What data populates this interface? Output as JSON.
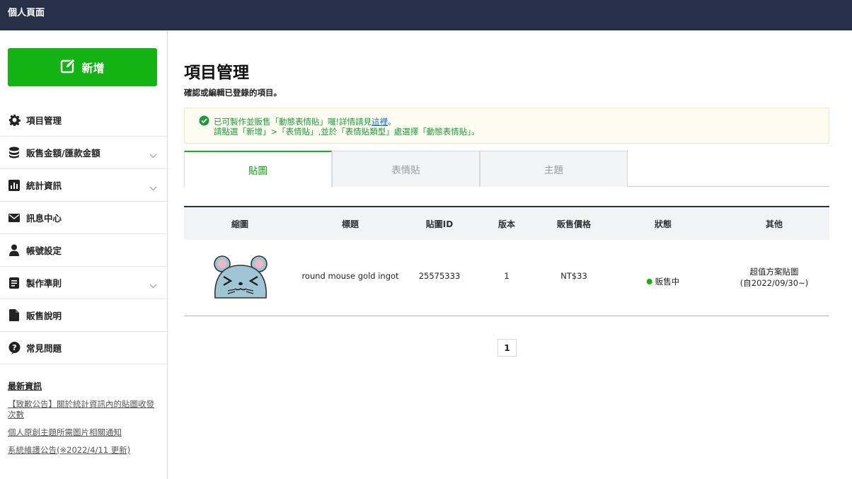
{
  "header": {
    "title": "個人頁面"
  },
  "sidebar": {
    "new_button_label": "新增",
    "items": [
      {
        "label": "項目管理",
        "icon": "gear-icon",
        "has_chevron": false
      },
      {
        "label": "販售金額/匯款金額",
        "icon": "coins-icon",
        "has_chevron": true
      },
      {
        "label": "統計資訊",
        "icon": "bar-chart-icon",
        "has_chevron": true
      },
      {
        "label": "訊息中心",
        "icon": "mail-icon",
        "has_chevron": false
      },
      {
        "label": "帳號設定",
        "icon": "user-icon",
        "has_chevron": false
      },
      {
        "label": "製作準則",
        "icon": "document-icon",
        "has_chevron": true
      },
      {
        "label": "販售說明",
        "icon": "file-icon",
        "has_chevron": false
      },
      {
        "label": "常見問題",
        "icon": "question-icon",
        "has_chevron": false
      }
    ],
    "news": {
      "title": "最新資訊",
      "links": [
        "【致歉公告】關於統計資訊內的貼圖收發次數",
        "個人原創主題所需圖片相關通知",
        "系統維護公告(※2022/4/11 更新)"
      ]
    }
  },
  "main": {
    "title": "項目管理",
    "subtitle": "確認或編輯已登錄的項目。",
    "notice": {
      "line1_before": "已可製作並販售「動態表情貼」囉!詳情請見",
      "line1_link": "這裡",
      "line1_after": "。",
      "line2": "請點選「新增」>「表情貼」,並於「表情貼類型」處選擇「動態表情貼」。"
    },
    "tabs": [
      "貼圖",
      "表情貼",
      "主題"
    ],
    "table": {
      "headers": [
        "縮圖",
        "標題",
        "貼圖ID",
        "版本",
        "販售價格",
        "狀態",
        "其他"
      ],
      "rows": [
        {
          "title": "round mouse gold ingot",
          "id": "25575333",
          "version": "1",
          "price": "NT$33",
          "status": "販售中",
          "other_line1": "超值方案貼圖",
          "other_line2": "(自2022/09/30~)"
        }
      ]
    },
    "pagination": {
      "current": "1"
    }
  },
  "colors": {
    "topbar": "#283048",
    "brand_green": "#12b312",
    "notice_text": "#1a9a3a",
    "link_blue": "#1a6cd1"
  }
}
